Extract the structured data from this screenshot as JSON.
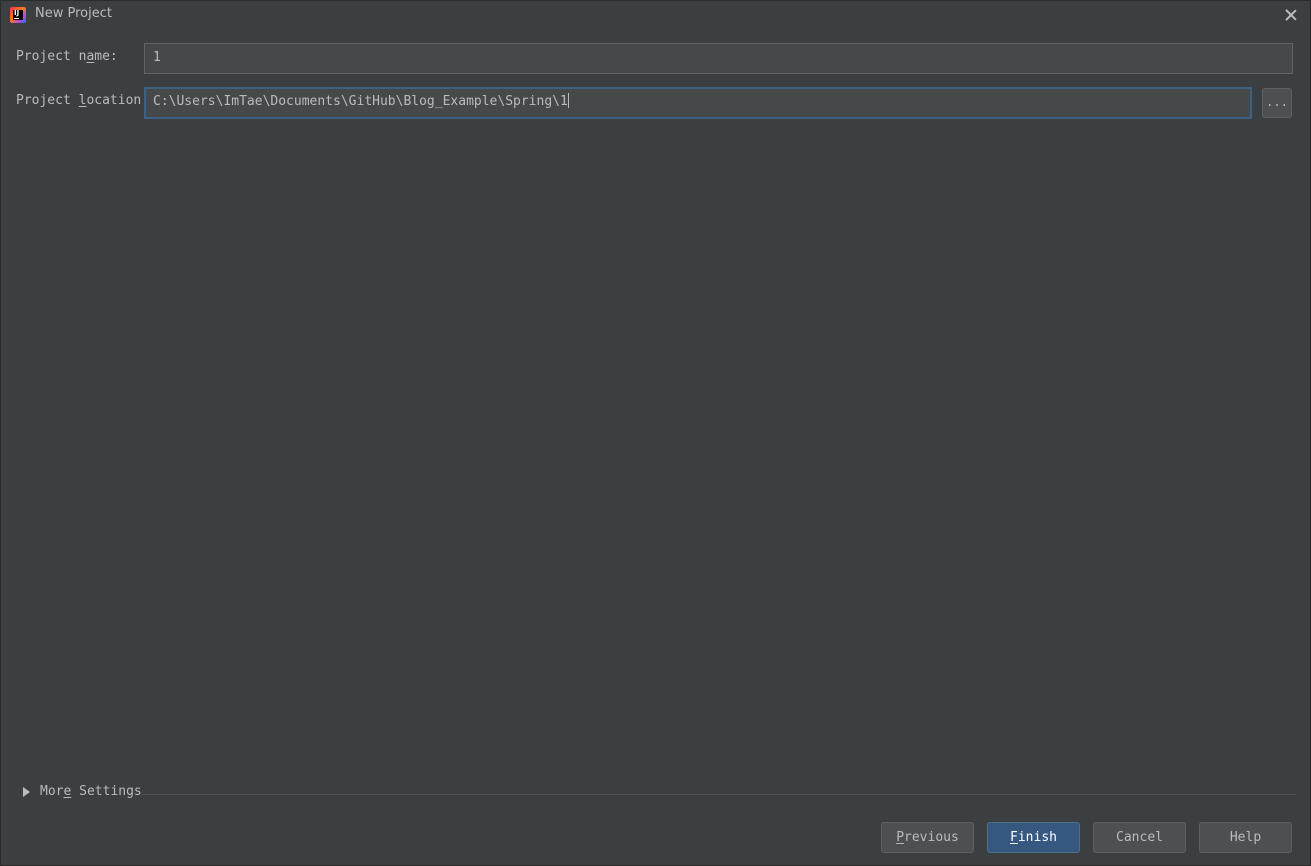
{
  "window": {
    "title": "New Project",
    "app_icon": "intellij-idea-icon",
    "close_icon": "close-icon"
  },
  "form": {
    "project_name": {
      "label_before": "Project n",
      "label_mnemonic": "a",
      "label_after": "me:",
      "value": "1"
    },
    "project_location": {
      "label_before": "Project ",
      "label_mnemonic": "l",
      "label_after": "ocation:",
      "value": "C:\\Users\\ImTae\\Documents\\GitHub\\Blog_Example\\Spring\\1",
      "browse_label": "..."
    }
  },
  "more_settings": {
    "label_before": "Mor",
    "label_mnemonic": "e",
    "label_after": " Settings",
    "expanded": false
  },
  "buttons": {
    "previous": {
      "mnemonic": "P",
      "rest": "revious"
    },
    "finish": {
      "mnemonic": "F",
      "rest": "inish"
    },
    "cancel": {
      "label": "Cancel"
    },
    "help": {
      "label": "Help"
    }
  },
  "colors": {
    "background": "#3c3f41",
    "field_background": "#45494a",
    "focus_border": "#3d6185",
    "primary_button": "#365880",
    "text": "#bbbbbb"
  }
}
